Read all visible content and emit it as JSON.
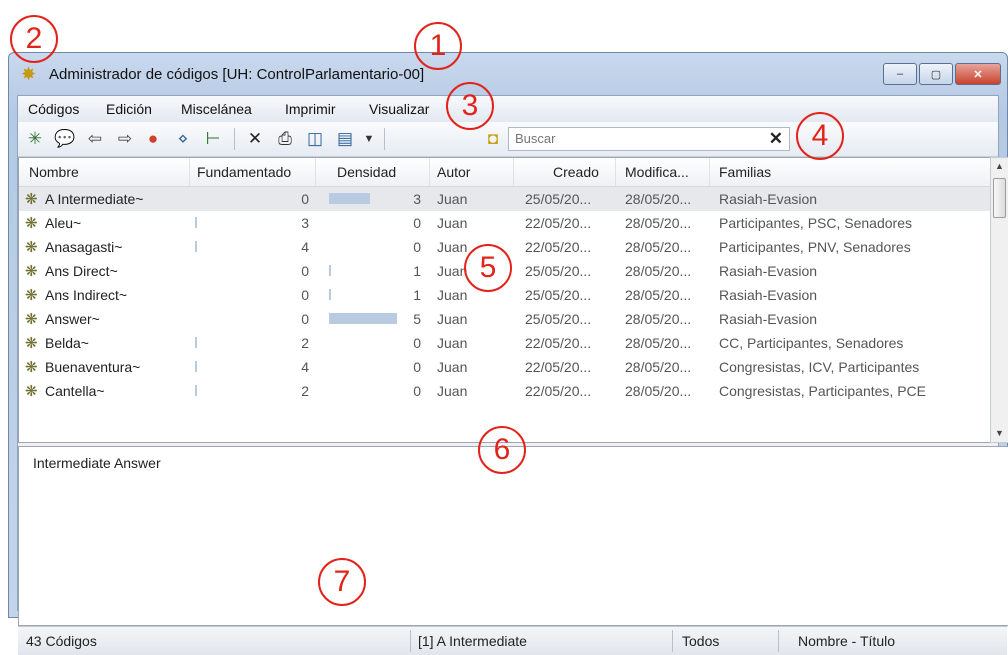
{
  "window": {
    "title": "Administrador de códigos [UH: ControlParlamentario-00]",
    "icon": "code-manager-icon",
    "controls": {
      "minimize": "–",
      "maximize": "▢",
      "close": "✕"
    }
  },
  "menu": {
    "items": [
      "Códigos",
      "Edición",
      "Miscelánea",
      "Imprimir",
      "Visualizar"
    ]
  },
  "toolbar": {
    "icons": [
      "new-code-icon",
      "comment-icon",
      "back-arrow-icon",
      "forward-arrow-icon",
      "color-wheel-icon",
      "link-icon",
      "network-icon",
      "delete-icon",
      "print-icon",
      "panel-icon",
      "view-icon",
      "dropdown-icon",
      "folder-icon"
    ],
    "search_placeholder": "Buscar",
    "clear_label": "✕"
  },
  "table": {
    "headers": [
      "Nombre",
      "Fundamentado",
      "Densidad",
      "Autor",
      "Creado",
      "Modifica...",
      "Familias"
    ],
    "rows": [
      {
        "name": "A Intermediate~",
        "fund": "0",
        "dens": "3",
        "dens_frac": 0.45,
        "fund_frac": 0,
        "autor": "Juan",
        "creado": "25/05/20...",
        "mod": "28/05/20...",
        "fam": "Rasiah-Evasion"
      },
      {
        "name": "Aleu~",
        "fund": "3",
        "dens": "0",
        "dens_frac": 0,
        "fund_frac": 0.04,
        "autor": "Juan",
        "creado": "22/05/20...",
        "mod": "28/05/20...",
        "fam": "Participantes, PSC, Senadores"
      },
      {
        "name": "Anasagasti~",
        "fund": "4",
        "dens": "0",
        "dens_frac": 0,
        "fund_frac": 0.05,
        "autor": "Juan",
        "creado": "22/05/20...",
        "mod": "28/05/20...",
        "fam": "Participantes, PNV, Senadores"
      },
      {
        "name": "Ans Direct~",
        "fund": "0",
        "dens": "1",
        "dens_frac": 0.05,
        "fund_frac": 0,
        "autor": "Juan",
        "creado": "25/05/20...",
        "mod": "28/05/20...",
        "fam": "Rasiah-Evasion"
      },
      {
        "name": "Ans Indirect~",
        "fund": "0",
        "dens": "1",
        "dens_frac": 0.05,
        "fund_frac": 0,
        "autor": "Juan",
        "creado": "25/05/20...",
        "mod": "28/05/20...",
        "fam": "Rasiah-Evasion"
      },
      {
        "name": "Answer~",
        "fund": "0",
        "dens": "5",
        "dens_frac": 0.75,
        "fund_frac": 0,
        "autor": "Juan",
        "creado": "25/05/20...",
        "mod": "28/05/20...",
        "fam": "Rasiah-Evasion"
      },
      {
        "name": "Belda~",
        "fund": "2",
        "dens": "0",
        "dens_frac": 0,
        "fund_frac": 0.03,
        "autor": "Juan",
        "creado": "22/05/20...",
        "mod": "28/05/20...",
        "fam": "CC, Participantes, Senadores"
      },
      {
        "name": "Buenaventura~",
        "fund": "4",
        "dens": "0",
        "dens_frac": 0,
        "fund_frac": 0.05,
        "autor": "Juan",
        "creado": "22/05/20...",
        "mod": "28/05/20...",
        "fam": "Congresistas, ICV, Participantes"
      },
      {
        "name": "Cantella~",
        "fund": "2",
        "dens": "0",
        "dens_frac": 0,
        "fund_frac": 0.03,
        "autor": "Juan",
        "creado": "22/05/20...",
        "mod": "28/05/20...",
        "fam": "Congresistas, Participantes, PCE"
      }
    ]
  },
  "comment": {
    "text": "Intermediate Answer"
  },
  "status": {
    "count": "43 Códigos",
    "selection": "[1] A Intermediate",
    "filter": "Todos",
    "sort": "Nombre - Título"
  },
  "callouts": [
    "1",
    "2",
    "3",
    "4",
    "5",
    "6",
    "7"
  ],
  "colors": {
    "callout": "#e2231a",
    "bar": "#b9cbe0",
    "selected_row": "#e6e8ec"
  }
}
